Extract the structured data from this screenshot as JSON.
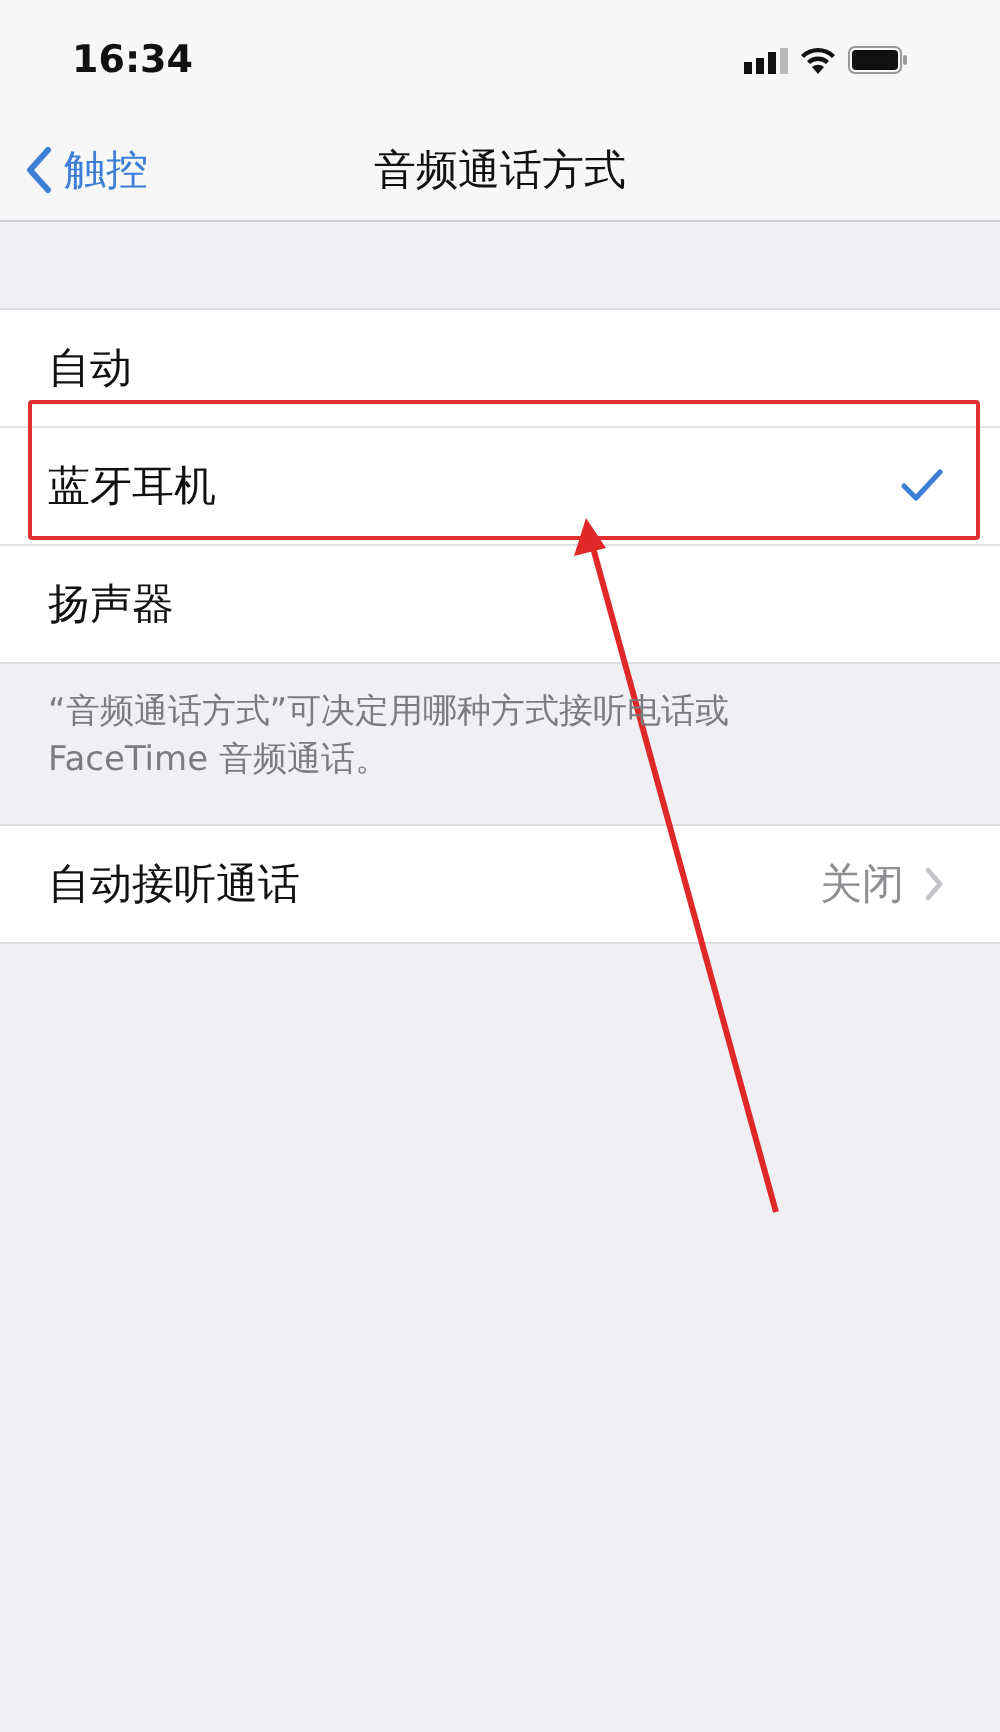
{
  "status_bar": {
    "time": "16:34"
  },
  "nav": {
    "back": "触控",
    "title": "音频通话方式"
  },
  "options": [
    {
      "label": "自动",
      "selected": false
    },
    {
      "label": "蓝牙耳机",
      "selected": true
    },
    {
      "label": "扬声器",
      "selected": false
    }
  ],
  "footer": "“音频通话方式”可决定用哪种方式接听电话或FaceTime 音频通话。",
  "settings": [
    {
      "label": "自动接听通话",
      "value": "关闭"
    }
  ]
}
